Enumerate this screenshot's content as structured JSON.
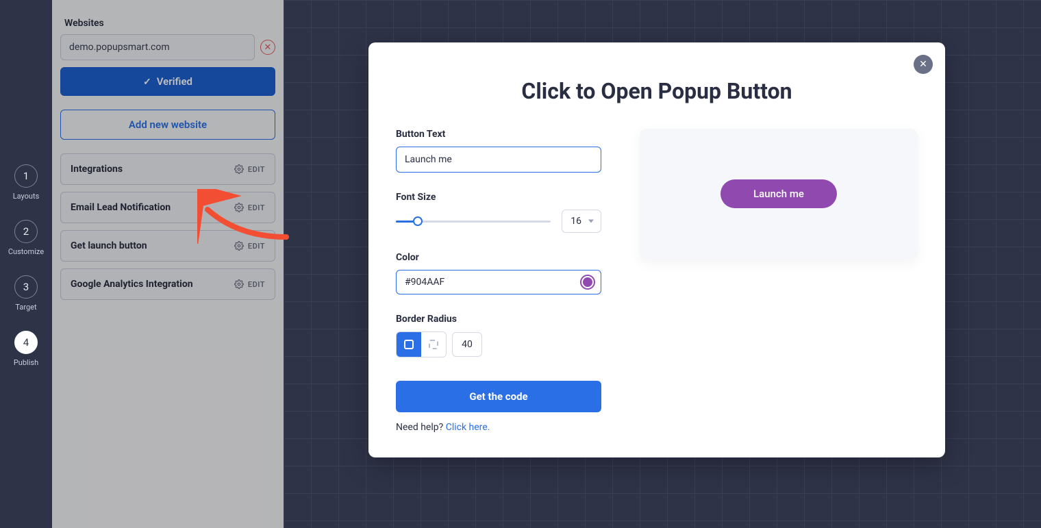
{
  "rail": {
    "steps": [
      {
        "num": "1",
        "label": "Layouts"
      },
      {
        "num": "2",
        "label": "Customize"
      },
      {
        "num": "3",
        "label": "Target"
      },
      {
        "num": "4",
        "label": "Publish"
      }
    ]
  },
  "panel": {
    "websites_label": "Websites",
    "website_value": "demo.popupsmart.com",
    "verified_label": "Verified",
    "add_website_label": "Add new website",
    "cards": [
      {
        "title": "Integrations",
        "action": "EDIT"
      },
      {
        "title": "Email Lead Notification",
        "action": "EDIT"
      },
      {
        "title": "Get launch button",
        "action": "EDIT"
      },
      {
        "title": "Google Analytics Integration",
        "action": "EDIT"
      }
    ]
  },
  "modal": {
    "title": "Click to Open Popup Button",
    "button_text_label": "Button Text",
    "button_text_value": "Launch me",
    "font_size_label": "Font Size",
    "font_size_value": "16",
    "color_label": "Color",
    "color_value": "#904AAF",
    "border_radius_label": "Border Radius",
    "border_radius_value": "40",
    "get_code_label": "Get the code",
    "help_text": "Need help? ",
    "help_link": "Click here.",
    "preview_label": "Launch me"
  }
}
